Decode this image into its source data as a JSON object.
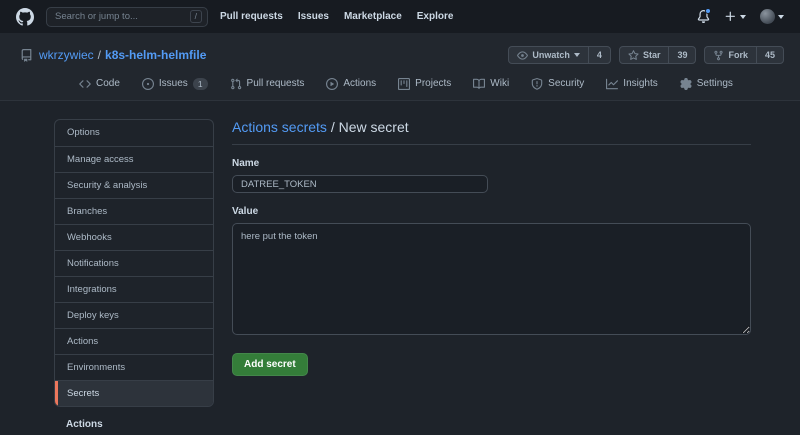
{
  "header": {
    "search_placeholder": "Search or jump to...",
    "search_shortcut": "/",
    "nav": [
      "Pull requests",
      "Issues",
      "Marketplace",
      "Explore"
    ]
  },
  "repo": {
    "owner": "wkrzywiec",
    "separator": "/",
    "name": "k8s-helm-helmfile",
    "social_buttons": [
      {
        "label": "Unwatch",
        "count": "4",
        "icon": "eye-icon"
      },
      {
        "label": "Star",
        "count": "39",
        "icon": "star-icon"
      },
      {
        "label": "Fork",
        "count": "45",
        "icon": "fork-icon"
      }
    ]
  },
  "tabs": [
    {
      "label": "Code",
      "icon": "code-icon"
    },
    {
      "label": "Issues",
      "icon": "issue-opened-icon",
      "badge": "1"
    },
    {
      "label": "Pull requests",
      "icon": "pull-request-icon"
    },
    {
      "label": "Actions",
      "icon": "play-circle-icon"
    },
    {
      "label": "Projects",
      "icon": "project-icon"
    },
    {
      "label": "Wiki",
      "icon": "book-icon"
    },
    {
      "label": "Security",
      "icon": "shield-icon"
    },
    {
      "label": "Insights",
      "icon": "graph-icon"
    },
    {
      "label": "Settings",
      "icon": "gear-icon"
    }
  ],
  "sidebar": {
    "items": [
      "Options",
      "Manage access",
      "Security & analysis",
      "Branches",
      "Webhooks",
      "Notifications",
      "Integrations",
      "Deploy keys",
      "Actions",
      "Environments",
      "Secrets"
    ],
    "selected_item": "Secrets",
    "section_header": "Actions"
  },
  "main": {
    "breadcrumb_link": "Actions secrets",
    "breadcrumb_separator": "/",
    "breadcrumb_current": "New secret",
    "name_label": "Name",
    "name_value": "DATREE_TOKEN",
    "value_label": "Value",
    "value_text": "here put the token",
    "submit_label": "Add secret"
  },
  "colors": {
    "accent_link": "#539bf5",
    "selected_marker": "#ec775c",
    "success_button": "#347d39",
    "notification_dot": "#539bf5"
  }
}
